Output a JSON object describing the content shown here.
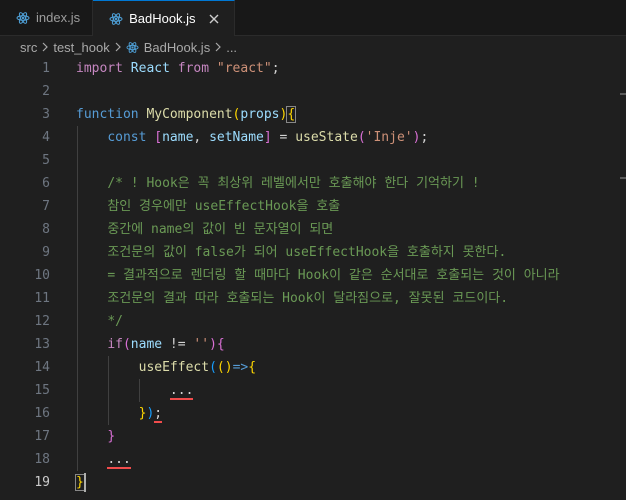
{
  "tabs": [
    {
      "label": "index.js",
      "active": false
    },
    {
      "label": "BadHook.js",
      "active": true
    }
  ],
  "breadcrumb": {
    "seg1": "src",
    "seg2": "test_hook",
    "file": "BadHook.js",
    "more": "..."
  },
  "colors": {
    "keyword": "#569cd6",
    "control": "#c586c0",
    "function": "#dcdcaa",
    "string": "#ce9178",
    "comment": "#6a9955",
    "variable": "#9cdcfe",
    "error_squiggle": "#f14c4c",
    "accent": "#0078d4"
  },
  "editor": {
    "active_line": 19,
    "line_numbers": [
      "1",
      "2",
      "3",
      "4",
      "5",
      "6",
      "7",
      "8",
      "9",
      "10",
      "11",
      "12",
      "13",
      "14",
      "15",
      "16",
      "17",
      "18",
      "19"
    ],
    "l1": {
      "import": "import",
      "react": "React",
      "from": "from",
      "module": "\"react\"",
      "semi": ";"
    },
    "l3": {
      "function": "function",
      "name": "MyComponent",
      "open": "(",
      "props": "props",
      "close": ")",
      "brace": "{"
    },
    "l4": {
      "const": "const",
      "lb": "[",
      "name": "name",
      "comma": ", ",
      "setName": "setName",
      "rb": "]",
      "eq": " = ",
      "useState": "useState",
      "open": "(",
      "arg": "'Inje'",
      "close": ")",
      "semi": ";"
    },
    "comment": [
      "/* ! Hook은 꼭 최상위 레벨에서만 호출해야 한다 기억하기 !",
      "참인 경우에만 useEffectHook을 호출",
      "중간에 name의 값이 빈 문자열이 되면",
      "조건문의 값이 false가 되어 useEffectHook을 호출하지 못한다.",
      "= 결과적으로 렌더링 할 때마다 Hook이 같은 순서대로 호출되는 것이 아니라",
      "조건문의 결과 따라 호출되는 Hook이 달라짐으로, 잘못된 코드이다.",
      "*/"
    ],
    "l13": {
      "if": "if",
      "open": "(",
      "name": "name",
      "op": " != ",
      "str": "''",
      "close": ")",
      "brace": "{"
    },
    "l14": {
      "useEffect": "useEffect",
      "open": "(",
      "params": "()",
      "arrow": "=>",
      "brace": "{"
    },
    "l15": {
      "dots": "..."
    },
    "l16": {
      "brace": "}",
      "close": ")",
      "semi": ";"
    },
    "l17": {
      "brace": "}"
    },
    "l18": {
      "dots": "..."
    },
    "l19": {
      "brace": "}"
    }
  }
}
